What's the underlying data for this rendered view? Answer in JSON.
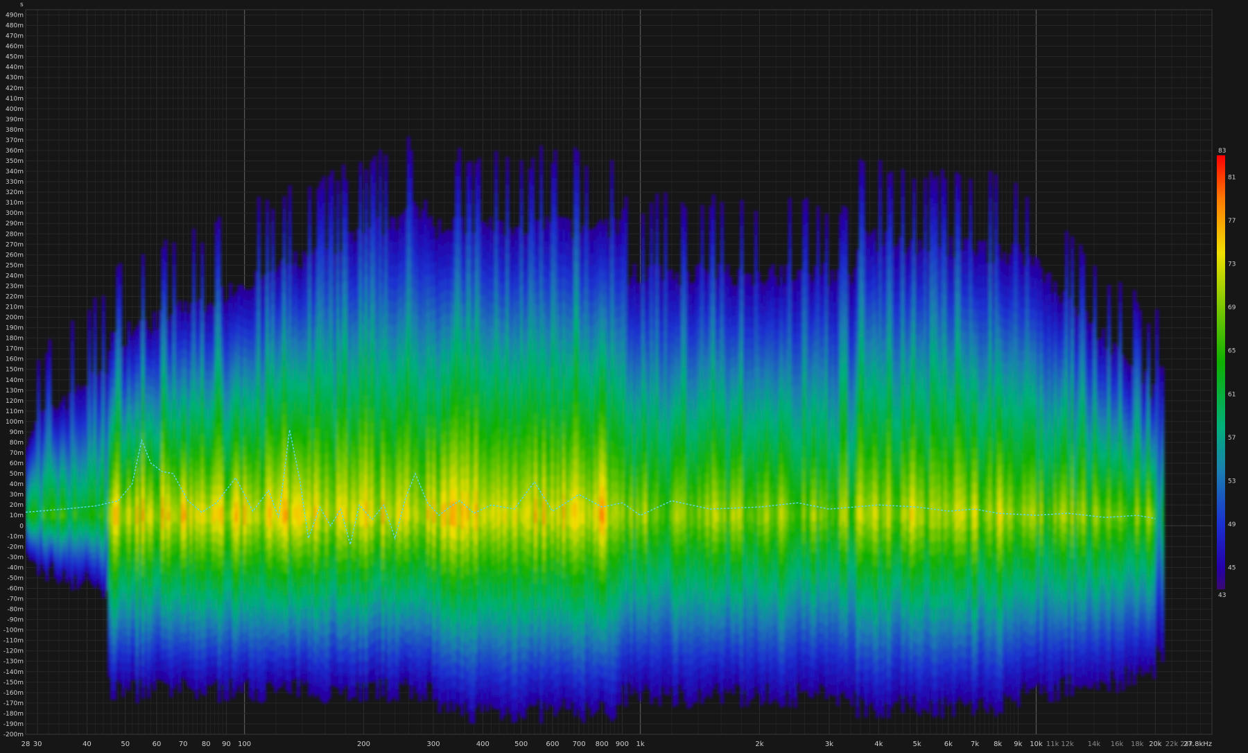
{
  "chart_data": {
    "type": "heatmap",
    "title": "",
    "y_unit_label": "s",
    "x_unit_label": "kHz",
    "x_scale": "log",
    "x_range_hz": [
      28,
      27800
    ],
    "y_range_ms": [
      -200,
      495
    ],
    "x_ticks": [
      {
        "hz": 28,
        "label": "28",
        "major": false
      },
      {
        "hz": 30,
        "label": "30",
        "major": false
      },
      {
        "hz": 40,
        "label": "40",
        "major": false
      },
      {
        "hz": 50,
        "label": "50",
        "major": false
      },
      {
        "hz": 60,
        "label": "60",
        "major": false
      },
      {
        "hz": 70,
        "label": "70",
        "major": false
      },
      {
        "hz": 80,
        "label": "80",
        "major": false
      },
      {
        "hz": 90,
        "label": "90",
        "major": false
      },
      {
        "hz": 100,
        "label": "100",
        "major": true
      },
      {
        "hz": 200,
        "label": "200",
        "major": false
      },
      {
        "hz": 300,
        "label": "300",
        "major": false
      },
      {
        "hz": 400,
        "label": "400",
        "major": false
      },
      {
        "hz": 500,
        "label": "500",
        "major": false
      },
      {
        "hz": 600,
        "label": "600",
        "major": false
      },
      {
        "hz": 700,
        "label": "700",
        "major": false
      },
      {
        "hz": 800,
        "label": "800",
        "major": false
      },
      {
        "hz": 900,
        "label": "900",
        "major": false
      },
      {
        "hz": 1000,
        "label": "1k",
        "major": true
      },
      {
        "hz": 2000,
        "label": "2k",
        "major": false
      },
      {
        "hz": 3000,
        "label": "3k",
        "major": false
      },
      {
        "hz": 4000,
        "label": "4k",
        "major": false
      },
      {
        "hz": 5000,
        "label": "5k",
        "major": false
      },
      {
        "hz": 6000,
        "label": "6k",
        "major": false
      },
      {
        "hz": 7000,
        "label": "7k",
        "major": false
      },
      {
        "hz": 8000,
        "label": "8k",
        "major": false
      },
      {
        "hz": 9000,
        "label": "9k",
        "major": false
      },
      {
        "hz": 10000,
        "label": "10k",
        "major": true
      },
      {
        "hz": 11000,
        "label": "11k",
        "major": false
      },
      {
        "hz": 12000,
        "label": "12k",
        "major": false
      },
      {
        "hz": 14000,
        "label": "14k",
        "major": false
      },
      {
        "hz": 16000,
        "label": "16k",
        "major": false
      },
      {
        "hz": 18000,
        "label": "18k",
        "major": false
      },
      {
        "hz": 20000,
        "label": "20k",
        "major": true
      },
      {
        "hz": 22000,
        "label": "22k",
        "major": false
      },
      {
        "hz": 24000,
        "label": "24k",
        "major": false
      },
      {
        "hz": 27800,
        "label": "27.8kHz",
        "major": false
      }
    ],
    "y_ticks": [
      {
        "ms": 490,
        "label": "490m"
      },
      {
        "ms": 480,
        "label": "480m"
      },
      {
        "ms": 470,
        "label": "470m"
      },
      {
        "ms": 460,
        "label": "460m"
      },
      {
        "ms": 450,
        "label": "450m"
      },
      {
        "ms": 440,
        "label": "440m"
      },
      {
        "ms": 430,
        "label": "430m"
      },
      {
        "ms": 420,
        "label": "420m"
      },
      {
        "ms": 410,
        "label": "410m"
      },
      {
        "ms": 400,
        "label": "400m"
      },
      {
        "ms": 390,
        "label": "390m"
      },
      {
        "ms": 380,
        "label": "380m"
      },
      {
        "ms": 370,
        "label": "370m"
      },
      {
        "ms": 360,
        "label": "360m"
      },
      {
        "ms": 350,
        "label": "350m"
      },
      {
        "ms": 340,
        "label": "340m"
      },
      {
        "ms": 330,
        "label": "330m"
      },
      {
        "ms": 320,
        "label": "320m"
      },
      {
        "ms": 310,
        "label": "310m"
      },
      {
        "ms": 300,
        "label": "300m"
      },
      {
        "ms": 290,
        "label": "290m"
      },
      {
        "ms": 280,
        "label": "280m"
      },
      {
        "ms": 270,
        "label": "270m"
      },
      {
        "ms": 260,
        "label": "260m"
      },
      {
        "ms": 250,
        "label": "250m"
      },
      {
        "ms": 240,
        "label": "240m"
      },
      {
        "ms": 230,
        "label": "230m"
      },
      {
        "ms": 220,
        "label": "220m"
      },
      {
        "ms": 210,
        "label": "210m"
      },
      {
        "ms": 200,
        "label": "200m"
      },
      {
        "ms": 190,
        "label": "190m"
      },
      {
        "ms": 180,
        "label": "180m"
      },
      {
        "ms": 170,
        "label": "170m"
      },
      {
        "ms": 160,
        "label": "160m"
      },
      {
        "ms": 150,
        "label": "150m"
      },
      {
        "ms": 140,
        "label": "140m"
      },
      {
        "ms": 130,
        "label": "130m"
      },
      {
        "ms": 120,
        "label": "120m"
      },
      {
        "ms": 110,
        "label": "110m"
      },
      {
        "ms": 100,
        "label": "100m"
      },
      {
        "ms": 90,
        "label": "90m"
      },
      {
        "ms": 80,
        "label": "80m"
      },
      {
        "ms": 70,
        "label": "70m"
      },
      {
        "ms": 60,
        "label": "60m"
      },
      {
        "ms": 50,
        "label": "50m"
      },
      {
        "ms": 40,
        "label": "40m"
      },
      {
        "ms": 30,
        "label": "30m"
      },
      {
        "ms": 20,
        "label": "20m"
      },
      {
        "ms": 10,
        "label": "10m"
      },
      {
        "ms": 0,
        "label": "0"
      },
      {
        "ms": -10,
        "label": "-10m"
      },
      {
        "ms": -20,
        "label": "-20m"
      },
      {
        "ms": -30,
        "label": "-30m"
      },
      {
        "ms": -40,
        "label": "-40m"
      },
      {
        "ms": -50,
        "label": "-50m"
      },
      {
        "ms": -60,
        "label": "-60m"
      },
      {
        "ms": -70,
        "label": "-70m"
      },
      {
        "ms": -80,
        "label": "-80m"
      },
      {
        "ms": -90,
        "label": "-90m"
      },
      {
        "ms": -100,
        "label": "-100m"
      },
      {
        "ms": -110,
        "label": "-110m"
      },
      {
        "ms": -120,
        "label": "-120m"
      },
      {
        "ms": -130,
        "label": "-130m"
      },
      {
        "ms": -140,
        "label": "-140m"
      },
      {
        "ms": -150,
        "label": "-150m"
      },
      {
        "ms": -160,
        "label": "-160m"
      },
      {
        "ms": -170,
        "label": "-170m"
      },
      {
        "ms": -180,
        "label": "-180m"
      },
      {
        "ms": -190,
        "label": "-190m"
      },
      {
        "ms": -200,
        "label": "-200m"
      }
    ],
    "colorbar": {
      "min": 43,
      "max": 83,
      "labels": [
        "83",
        "81",
        "77",
        "73",
        "69",
        "65",
        "61",
        "57",
        "53",
        "49",
        "45",
        "43"
      ],
      "stops": [
        {
          "value": 83,
          "color": "#ff0000"
        },
        {
          "value": 79,
          "color": "#ff7a00"
        },
        {
          "value": 74,
          "color": "#f0e000"
        },
        {
          "value": 69,
          "color": "#7cc800"
        },
        {
          "value": 64,
          "color": "#0fb000"
        },
        {
          "value": 58,
          "color": "#00b07a"
        },
        {
          "value": 54,
          "color": "#1b80b0"
        },
        {
          "value": 49,
          "color": "#1a30d0"
        },
        {
          "value": 45,
          "color": "#2400a8"
        },
        {
          "value": 43,
          "color": "#3a0a70"
        }
      ]
    },
    "grid": true,
    "background_color": "#161616",
    "group_delay_trace_color": "#5ad8e6",
    "group_delay_ms": [
      [
        28,
        13
      ],
      [
        35,
        16
      ],
      [
        42,
        19
      ],
      [
        48,
        24
      ],
      [
        52,
        40
      ],
      [
        55,
        82
      ],
      [
        58,
        60
      ],
      [
        62,
        52
      ],
      [
        66,
        50
      ],
      [
        72,
        24
      ],
      [
        78,
        13
      ],
      [
        85,
        22
      ],
      [
        95,
        46
      ],
      [
        100,
        30
      ],
      [
        105,
        14
      ],
      [
        115,
        34
      ],
      [
        122,
        8
      ],
      [
        130,
        92
      ],
      [
        138,
        44
      ],
      [
        145,
        -12
      ],
      [
        155,
        18
      ],
      [
        165,
        0
      ],
      [
        175,
        16
      ],
      [
        185,
        -18
      ],
      [
        195,
        20
      ],
      [
        210,
        6
      ],
      [
        225,
        20
      ],
      [
        240,
        -12
      ],
      [
        255,
        26
      ],
      [
        270,
        50
      ],
      [
        290,
        22
      ],
      [
        310,
        10
      ],
      [
        330,
        18
      ],
      [
        350,
        24
      ],
      [
        380,
        12
      ],
      [
        420,
        20
      ],
      [
        480,
        16
      ],
      [
        540,
        42
      ],
      [
        600,
        14
      ],
      [
        700,
        30
      ],
      [
        800,
        18
      ],
      [
        900,
        22
      ],
      [
        1000,
        10
      ],
      [
        1200,
        24
      ],
      [
        1500,
        16
      ],
      [
        2000,
        18
      ],
      [
        2500,
        22
      ],
      [
        3000,
        16
      ],
      [
        4000,
        20
      ],
      [
        5000,
        18
      ],
      [
        6000,
        14
      ],
      [
        7000,
        16
      ],
      [
        8000,
        12
      ],
      [
        10000,
        10
      ],
      [
        12000,
        12
      ],
      [
        15000,
        8
      ],
      [
        18000,
        10
      ],
      [
        20000,
        7
      ]
    ]
  }
}
